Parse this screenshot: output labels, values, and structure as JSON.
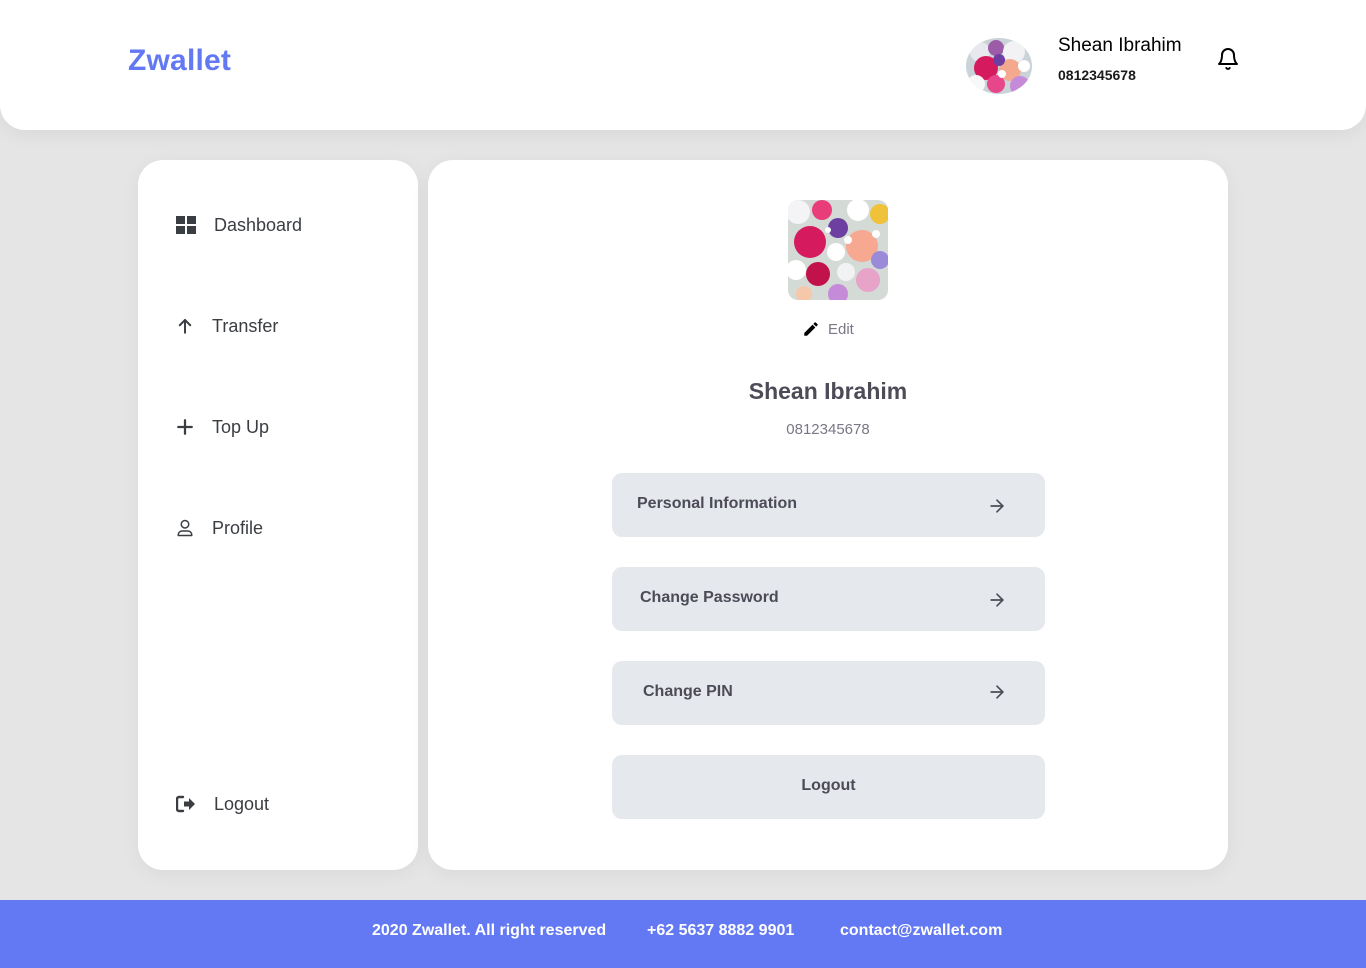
{
  "brand": "Zwallet",
  "header": {
    "user_name": "Shean Ibrahim",
    "user_phone": "0812345678",
    "avatar_icon": "flowers-photo",
    "notification_icon": "bell-icon"
  },
  "sidebar": {
    "items": [
      {
        "label": "Dashboard",
        "icon": "grid-icon"
      },
      {
        "label": "Transfer",
        "icon": "arrow-up-icon"
      },
      {
        "label": "Top Up",
        "icon": "plus-icon"
      },
      {
        "label": "Profile",
        "icon": "user-icon"
      }
    ],
    "logout": {
      "label": "Logout",
      "icon": "logout-icon"
    }
  },
  "profile": {
    "edit_label": "Edit",
    "name": "Shean Ibrahim",
    "phone": "0812345678"
  },
  "menu": {
    "personal_info": "Personal Information",
    "change_password": "Change Password",
    "change_pin": "Change PIN",
    "logout": "Logout"
  },
  "footer": {
    "copyright": "2020 Zwallet. All right reserved",
    "phone": "+62 5637 8882 9901",
    "email": "contact@zwallet.com"
  },
  "colors": {
    "primary": "#6379f4",
    "background": "#e5e5e5",
    "button_bg": "#e5e8ed",
    "text_dark": "#4d4b57",
    "text_muted": "#7a7886"
  }
}
